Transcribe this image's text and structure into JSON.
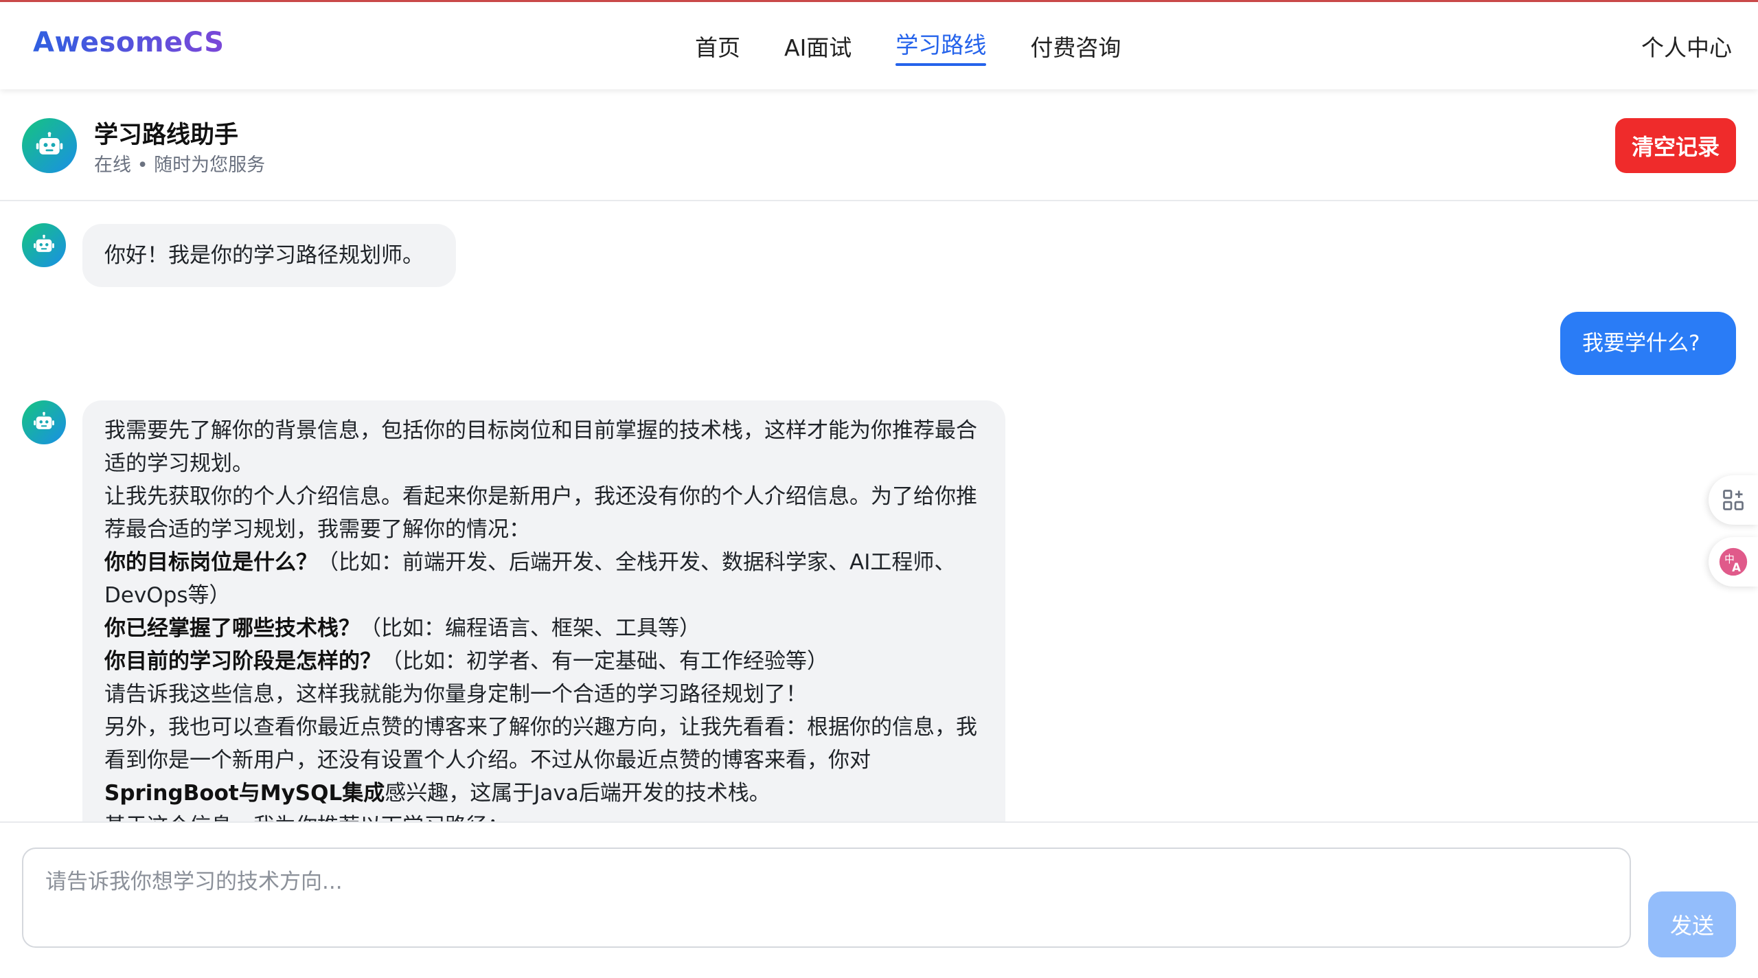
{
  "nav": {
    "brand": "AwesomeCS",
    "items": [
      {
        "label": "首页",
        "active": false
      },
      {
        "label": "AI面试",
        "active": false
      },
      {
        "label": "学习路线",
        "active": true
      },
      {
        "label": "付费咨询",
        "active": false
      }
    ],
    "user_center": "个人中心"
  },
  "chat_header": {
    "avatar_icon": "robot-icon",
    "title": "学习路线助手",
    "status": "在线 • 随时为您服务",
    "clear_button": "清空记录"
  },
  "messages": [
    {
      "role": "bot",
      "text": "你好！我是你的学习路径规划师。"
    },
    {
      "role": "user",
      "text": "我要学什么?"
    },
    {
      "role": "bot",
      "lines": [
        {
          "text": "我需要先了解你的背景信息，包括你的目标岗位和目前掌握的技术栈，这样才能为你推荐最合适的学习规划。"
        },
        {
          "text": "让我先获取你的个人介绍信息。看起来你是新用户，我还没有你的个人介绍信息。为了给你推荐最合适的学习规划，我需要了解你的情况："
        },
        {
          "bold": "你的目标岗位是什么？",
          "text": "（比如：前端开发、后端开发、全栈开发、数据科学家、AI工程师、DevOps等）"
        },
        {
          "bold": "你已经掌握了哪些技术栈？",
          "text": "（比如：编程语言、框架、工具等）"
        },
        {
          "bold": "你目前的学习阶段是怎样的？",
          "text": "（比如：初学者、有一定基础、有工作经验等）"
        },
        {
          "text": "请告诉我这些信息，这样我就能为你量身定制一个合适的学习路径规划了！"
        },
        {
          "text": "另外，我也可以查看你最近点赞的博客来了解你的兴趣方向，让我先看看：根据你的信息，我看到你是一个新用户，还没有设置个人介绍。不过从你最近点赞的博客来看，你对"
        },
        {
          "bold": "SpringBoot与MySQL集成",
          "text": "感兴趣，这属于Java后端开发的技术栈。"
        },
        {
          "text": "基于这个信息，我为你推荐以下学习路径："
        }
      ]
    }
  ],
  "side_tools": [
    {
      "icon": "grid-plus-icon",
      "color": "#6b7280"
    },
    {
      "icon": "translate-icon",
      "color": "#e05a8a"
    }
  ],
  "composer": {
    "placeholder": "请告诉我你想学习的技术方向...",
    "send_button": "发送"
  },
  "colors": {
    "brand_start": "#2f5fe0",
    "brand_end": "#7b47d8",
    "accent": "#2563eb",
    "danger": "#ef2b2b",
    "user_bubble": "#2a7cf6",
    "bot_bubble": "#f2f3f5",
    "send_disabled": "#93bdfb"
  }
}
